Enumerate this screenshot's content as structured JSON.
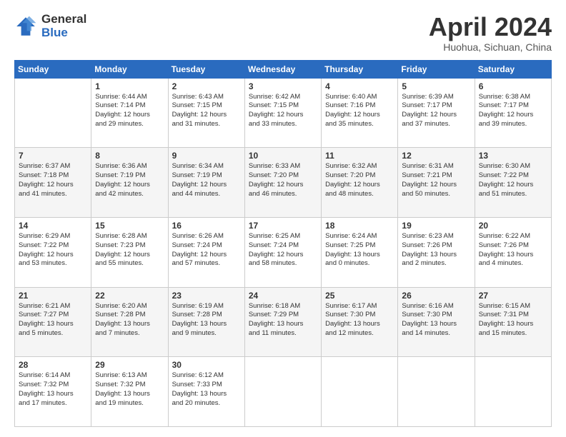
{
  "header": {
    "logo_general": "General",
    "logo_blue": "Blue",
    "title": "April 2024",
    "location": "Huohua, Sichuan, China"
  },
  "weekdays": [
    "Sunday",
    "Monday",
    "Tuesday",
    "Wednesday",
    "Thursday",
    "Friday",
    "Saturday"
  ],
  "rows": [
    {
      "shade": "white",
      "cells": [
        {
          "day": "",
          "info": ""
        },
        {
          "day": "1",
          "info": "Sunrise: 6:44 AM\nSunset: 7:14 PM\nDaylight: 12 hours\nand 29 minutes."
        },
        {
          "day": "2",
          "info": "Sunrise: 6:43 AM\nSunset: 7:15 PM\nDaylight: 12 hours\nand 31 minutes."
        },
        {
          "day": "3",
          "info": "Sunrise: 6:42 AM\nSunset: 7:15 PM\nDaylight: 12 hours\nand 33 minutes."
        },
        {
          "day": "4",
          "info": "Sunrise: 6:40 AM\nSunset: 7:16 PM\nDaylight: 12 hours\nand 35 minutes."
        },
        {
          "day": "5",
          "info": "Sunrise: 6:39 AM\nSunset: 7:17 PM\nDaylight: 12 hours\nand 37 minutes."
        },
        {
          "day": "6",
          "info": "Sunrise: 6:38 AM\nSunset: 7:17 PM\nDaylight: 12 hours\nand 39 minutes."
        }
      ]
    },
    {
      "shade": "shaded",
      "cells": [
        {
          "day": "7",
          "info": "Sunrise: 6:37 AM\nSunset: 7:18 PM\nDaylight: 12 hours\nand 41 minutes."
        },
        {
          "day": "8",
          "info": "Sunrise: 6:36 AM\nSunset: 7:19 PM\nDaylight: 12 hours\nand 42 minutes."
        },
        {
          "day": "9",
          "info": "Sunrise: 6:34 AM\nSunset: 7:19 PM\nDaylight: 12 hours\nand 44 minutes."
        },
        {
          "day": "10",
          "info": "Sunrise: 6:33 AM\nSunset: 7:20 PM\nDaylight: 12 hours\nand 46 minutes."
        },
        {
          "day": "11",
          "info": "Sunrise: 6:32 AM\nSunset: 7:20 PM\nDaylight: 12 hours\nand 48 minutes."
        },
        {
          "day": "12",
          "info": "Sunrise: 6:31 AM\nSunset: 7:21 PM\nDaylight: 12 hours\nand 50 minutes."
        },
        {
          "day": "13",
          "info": "Sunrise: 6:30 AM\nSunset: 7:22 PM\nDaylight: 12 hours\nand 51 minutes."
        }
      ]
    },
    {
      "shade": "white",
      "cells": [
        {
          "day": "14",
          "info": "Sunrise: 6:29 AM\nSunset: 7:22 PM\nDaylight: 12 hours\nand 53 minutes."
        },
        {
          "day": "15",
          "info": "Sunrise: 6:28 AM\nSunset: 7:23 PM\nDaylight: 12 hours\nand 55 minutes."
        },
        {
          "day": "16",
          "info": "Sunrise: 6:26 AM\nSunset: 7:24 PM\nDaylight: 12 hours\nand 57 minutes."
        },
        {
          "day": "17",
          "info": "Sunrise: 6:25 AM\nSunset: 7:24 PM\nDaylight: 12 hours\nand 58 minutes."
        },
        {
          "day": "18",
          "info": "Sunrise: 6:24 AM\nSunset: 7:25 PM\nDaylight: 13 hours\nand 0 minutes."
        },
        {
          "day": "19",
          "info": "Sunrise: 6:23 AM\nSunset: 7:26 PM\nDaylight: 13 hours\nand 2 minutes."
        },
        {
          "day": "20",
          "info": "Sunrise: 6:22 AM\nSunset: 7:26 PM\nDaylight: 13 hours\nand 4 minutes."
        }
      ]
    },
    {
      "shade": "shaded",
      "cells": [
        {
          "day": "21",
          "info": "Sunrise: 6:21 AM\nSunset: 7:27 PM\nDaylight: 13 hours\nand 5 minutes."
        },
        {
          "day": "22",
          "info": "Sunrise: 6:20 AM\nSunset: 7:28 PM\nDaylight: 13 hours\nand 7 minutes."
        },
        {
          "day": "23",
          "info": "Sunrise: 6:19 AM\nSunset: 7:28 PM\nDaylight: 13 hours\nand 9 minutes."
        },
        {
          "day": "24",
          "info": "Sunrise: 6:18 AM\nSunset: 7:29 PM\nDaylight: 13 hours\nand 11 minutes."
        },
        {
          "day": "25",
          "info": "Sunrise: 6:17 AM\nSunset: 7:30 PM\nDaylight: 13 hours\nand 12 minutes."
        },
        {
          "day": "26",
          "info": "Sunrise: 6:16 AM\nSunset: 7:30 PM\nDaylight: 13 hours\nand 14 minutes."
        },
        {
          "day": "27",
          "info": "Sunrise: 6:15 AM\nSunset: 7:31 PM\nDaylight: 13 hours\nand 15 minutes."
        }
      ]
    },
    {
      "shade": "white",
      "cells": [
        {
          "day": "28",
          "info": "Sunrise: 6:14 AM\nSunset: 7:32 PM\nDaylight: 13 hours\nand 17 minutes."
        },
        {
          "day": "29",
          "info": "Sunrise: 6:13 AM\nSunset: 7:32 PM\nDaylight: 13 hours\nand 19 minutes."
        },
        {
          "day": "30",
          "info": "Sunrise: 6:12 AM\nSunset: 7:33 PM\nDaylight: 13 hours\nand 20 minutes."
        },
        {
          "day": "",
          "info": ""
        },
        {
          "day": "",
          "info": ""
        },
        {
          "day": "",
          "info": ""
        },
        {
          "day": "",
          "info": ""
        }
      ]
    }
  ]
}
